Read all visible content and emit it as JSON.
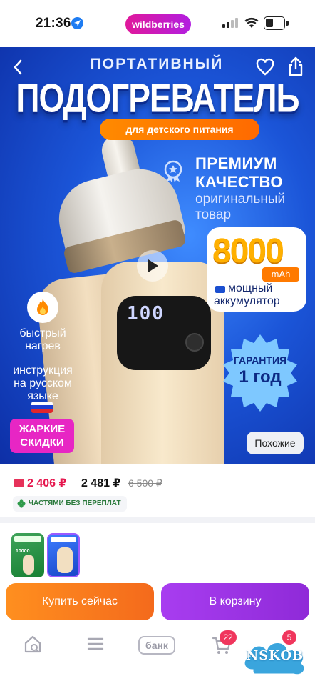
{
  "status_bar": {
    "time": "21:36",
    "app_pill": "wildberries"
  },
  "hero": {
    "title_top": "ПОРТАТИВНЫЙ",
    "title_main": "ПОДОГРЕВАТЕЛЬ",
    "subtitle_badge": "для детского питания",
    "premium_line1": "ПРЕМИУМ",
    "premium_line2": "КАЧЕСТВО",
    "premium_line3": "оригинальный",
    "premium_line4": "товар",
    "battery_capacity": "8000",
    "battery_unit": "mAh",
    "battery_line1": "мощный",
    "battery_line2": "аккумулятор",
    "warranty_line1": "ГАРАНТИЯ",
    "warranty_line2": "1 год",
    "fast_line1": "быстрый",
    "fast_line2": "нагрев",
    "instr_line1": "инструкция",
    "instr_line2": "на русском",
    "instr_line3": "языке",
    "hot_line1": "ЖАРКИЕ",
    "hot_line2": "СКИДКИ",
    "similar_label": "Похожие",
    "screen_digits": "100"
  },
  "prices": {
    "wallet_price": "2 406 ₽",
    "card_price": "2 481 ₽",
    "old_price": "6 500 ₽",
    "installment": "ЧАСТЯМИ БЕЗ ПЕРЕПЛАТ"
  },
  "thumbs": {
    "thumb1_caption": "10000"
  },
  "actions": {
    "buy_now": "Купить сейчас",
    "to_cart": "В корзину"
  },
  "bottom_nav": {
    "bank_label": "банк",
    "cart_count": "22",
    "profile_count": "5"
  },
  "watermark": "NSKOB",
  "colors": {
    "brand_gradient_start": "#e0189b",
    "brand_gradient_end": "#b21ee0",
    "price_red": "#e5164d",
    "buy_orange": "#ff8f1f",
    "cart_purple": "#a83df0",
    "hero_blue": "#1b55d8"
  }
}
